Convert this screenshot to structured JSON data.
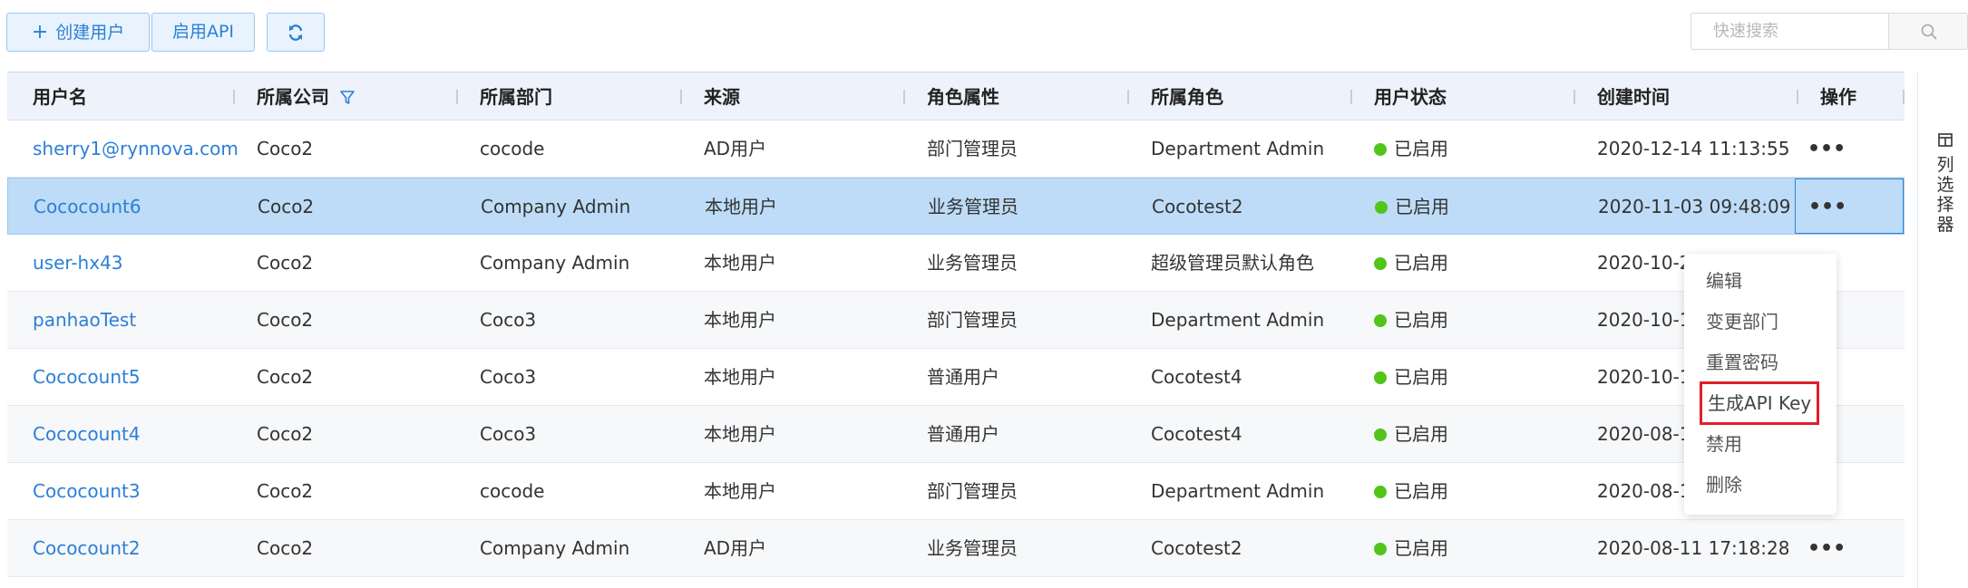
{
  "toolbar": {
    "create_user_label": "创建用户",
    "enable_api_label": "启用API"
  },
  "search": {
    "placeholder": "快速搜索",
    "value": ""
  },
  "table": {
    "columns": [
      "用户名",
      "所属公司",
      "所属部门",
      "来源",
      "角色属性",
      "所属角色",
      "用户状态",
      "创建时间",
      "操作"
    ],
    "rows": [
      {
        "username": "sherry1@rynnova.com",
        "company": "Coco2",
        "department": "cocode",
        "source": "AD用户",
        "role_attr": "部门管理员",
        "role": "Department Admin",
        "status": "已启用",
        "created": "2020-12-14 11:13:55"
      },
      {
        "username": "Cococount6",
        "company": "Coco2",
        "department": "Company Admin",
        "source": "本地用户",
        "role_attr": "业务管理员",
        "role": "Cocotest2",
        "status": "已启用",
        "created": "2020-11-03 09:48:09"
      },
      {
        "username": "user-hx43",
        "company": "Coco2",
        "department": "Company Admin",
        "source": "本地用户",
        "role_attr": "业务管理员",
        "role": "超级管理员默认角色",
        "status": "已启用",
        "created": "2020-10-2"
      },
      {
        "username": "panhaoTest",
        "company": "Coco2",
        "department": "Coco3",
        "source": "本地用户",
        "role_attr": "部门管理员",
        "role": "Department Admin",
        "status": "已启用",
        "created": "2020-10-1"
      },
      {
        "username": "Cococount5",
        "company": "Coco2",
        "department": "Coco3",
        "source": "本地用户",
        "role_attr": "普通用户",
        "role": "Cocotest4",
        "status": "已启用",
        "created": "2020-10-1"
      },
      {
        "username": "Cococount4",
        "company": "Coco2",
        "department": "Coco3",
        "source": "本地用户",
        "role_attr": "普通用户",
        "role": "Cocotest4",
        "status": "已启用",
        "created": "2020-08-1"
      },
      {
        "username": "Cococount3",
        "company": "Coco2",
        "department": "cocode",
        "source": "本地用户",
        "role_attr": "部门管理员",
        "role": "Department Admin",
        "status": "已启用",
        "created": "2020-08-1"
      },
      {
        "username": "Cococount2",
        "company": "Coco2",
        "department": "Company Admin",
        "source": "AD用户",
        "role_attr": "业务管理员",
        "role": "Cocotest2",
        "status": "已启用",
        "created": "2020-08-11 17:18:28"
      }
    ],
    "selected_row": 1,
    "status_color": "#52c41a"
  },
  "menu": {
    "items": [
      "编辑",
      "变更部门",
      "重置密码",
      "生成API Key",
      "禁用",
      "删除"
    ],
    "highlighted_item": "生成API Key",
    "highlight_color": "#e0202a"
  },
  "column_picker": {
    "label": "列选择器",
    "icon": "columns-icon"
  },
  "icons": {
    "create": "plus-icon",
    "refresh": "refresh-icon",
    "search": "search-icon",
    "filter": "filter-icon",
    "more": "more-icon"
  },
  "colors": {
    "accent": "#2b7fd6",
    "selected_row_bg": "#bedcf7"
  }
}
